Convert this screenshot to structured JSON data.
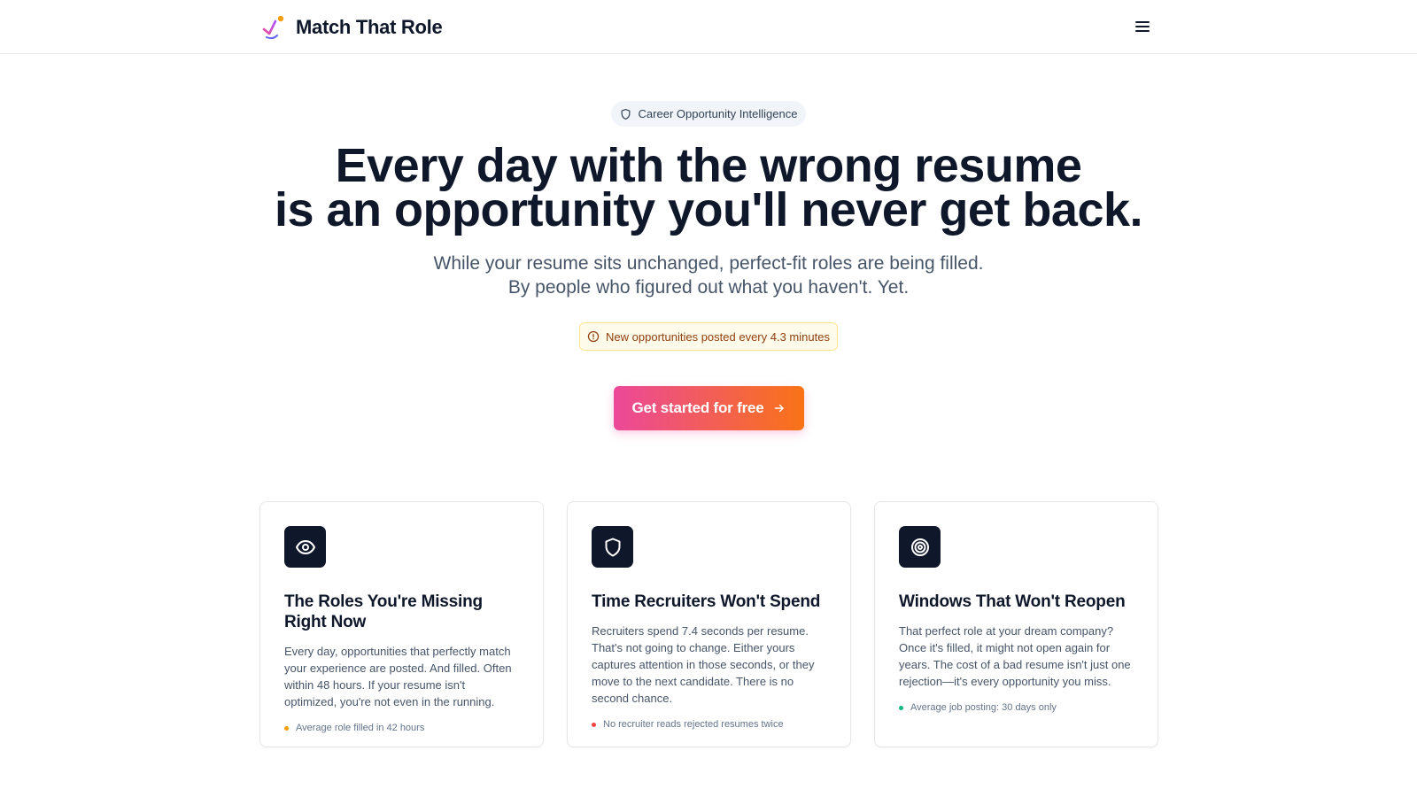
{
  "header": {
    "brand_name": "Match That Role",
    "logo_icon": "checkmark-spark-logo",
    "menu_icon": "hamburger-menu-icon"
  },
  "hero": {
    "badge_icon": "shield-icon",
    "badge_text": "Career Opportunity Intelligence",
    "title_line1": "Every day with the wrong resume",
    "title_line2": "is an opportunity you'll never get back.",
    "subtitle_line1": "While your resume sits unchanged, perfect-fit roles are being filled.",
    "subtitle_line2": "By people who figured out what you haven't. Yet.",
    "alert_icon": "alert-circle-icon",
    "alert_text": "New opportunities posted every 4.3 minutes",
    "cta_label": "Get started for free",
    "cta_icon": "arrow-right-icon"
  },
  "cards": [
    {
      "icon": "eye-icon",
      "title": "The Roles You're Missing Right Now",
      "body": "Every day, opportunities that perfectly match your experience are posted. And filled. Often within 48 hours. If your resume isn't optimized, you're not even in the running.",
      "note": "Average role filled in 42 hours",
      "note_color": "#f59e0b"
    },
    {
      "icon": "shield-icon",
      "title": "Time Recruiters Won't Spend",
      "body": "Recruiters spend 7.4 seconds per resume. That's not going to change. Either yours captures attention in those seconds, or they move to the next candidate. There is no second chance.",
      "note": "No recruiter reads rejected resumes twice",
      "note_color": "#ef4444"
    },
    {
      "icon": "target-icon",
      "title": "Windows That Won't Reopen",
      "body": "That perfect role at your dream company? Once it's filled, it might not open again for years. The cost of a bad resume isn't just one rejection—it's every opportunity you miss.",
      "note": "Average job posting: 30 days only",
      "note_color": "#10b981"
    }
  ],
  "colors": {
    "brand_gradient_start": "#ec4899",
    "brand_gradient_end": "#f97316",
    "dark": "#0f172a"
  }
}
